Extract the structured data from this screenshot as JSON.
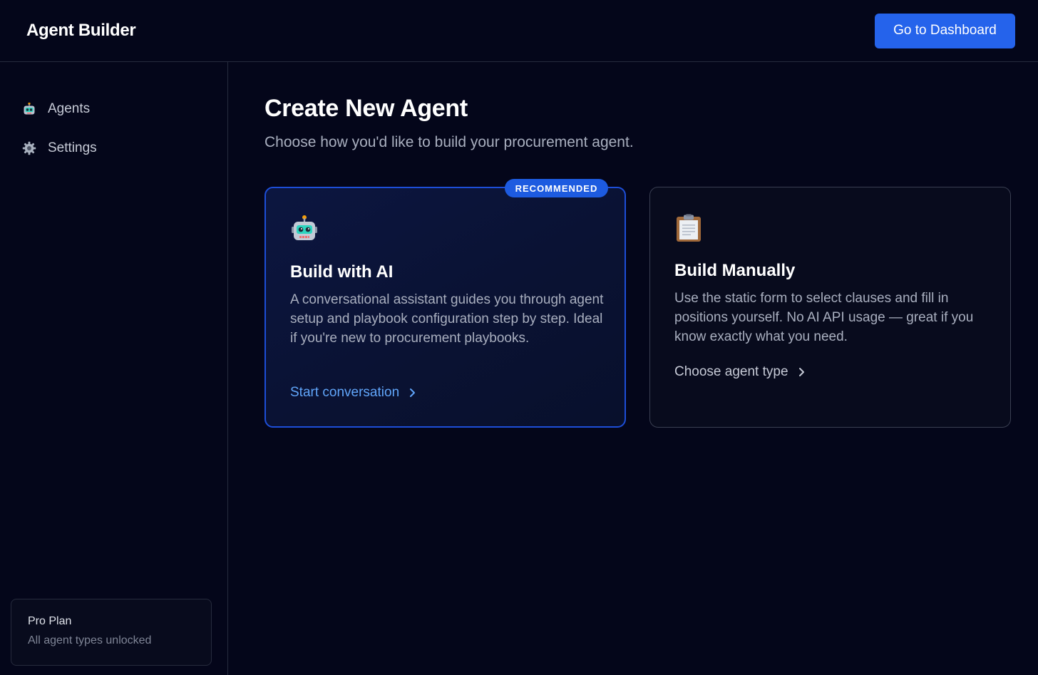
{
  "header": {
    "app_title": "Agent Builder",
    "dashboard_button": "Go to Dashboard"
  },
  "sidebar": {
    "items": [
      {
        "label": "Agents",
        "icon": "robot-icon"
      },
      {
        "label": "Settings",
        "icon": "gear-icon"
      }
    ],
    "plan": {
      "title": "Pro Plan",
      "subtitle": "All agent types unlocked"
    }
  },
  "main": {
    "title": "Create New Agent",
    "subtitle": "Choose how you'd like to build your procurement agent.",
    "cards": [
      {
        "badge": "RECOMMENDED",
        "icon": "robot-icon",
        "title": "Build with AI",
        "description": "A conversational assistant guides you through agent setup and playbook configuration step by step. Ideal if you're new to procurement playbooks.",
        "link": "Start conversation"
      },
      {
        "icon": "clipboard-icon",
        "title": "Build Manually",
        "description": "Use the static form to select clauses and fill in positions yourself. No AI API usage — great if you know exactly what you need.",
        "link": "Choose agent type"
      }
    ]
  },
  "colors": {
    "background": "#04061a",
    "accent": "#2563eb",
    "link_ai": "#60a5fa",
    "border": "#262b3d"
  }
}
